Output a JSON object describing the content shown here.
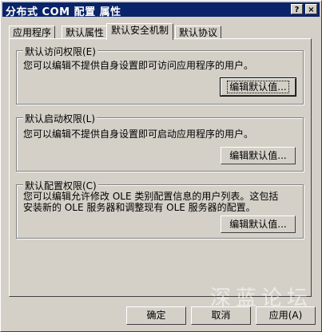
{
  "window": {
    "title": "分布式 COM 配置 属性",
    "help_button": "?",
    "close_button": "×"
  },
  "tabs": [
    {
      "label": "应用程序"
    },
    {
      "label": "默认属性"
    },
    {
      "label": "默认安全机制",
      "active": true
    },
    {
      "label": "默认协议"
    }
  ],
  "groups": [
    {
      "title": "默认访问权限(E)",
      "description": "您可以编辑不提供自身设置即可访问应用程序的用户。",
      "button": "编辑默认值..."
    },
    {
      "title": "默认启动权限(L)",
      "description": "您可以编辑不提供自身设置即可启动应用程序的用户。",
      "button": "编辑默认值..."
    },
    {
      "title": "默认配置权限(C)",
      "description_line1": "您可以编辑允许修改 OLE 类别配置信息的用户列表。这包括",
      "description_line2": "安装新的 OLE 服务器和调整现有 OLE 服务器的配置。",
      "button": "编辑默认值..."
    }
  ],
  "footer": {
    "ok": "确定",
    "cancel": "取消",
    "apply": "应用(A)"
  },
  "watermark": "深蓝论坛"
}
